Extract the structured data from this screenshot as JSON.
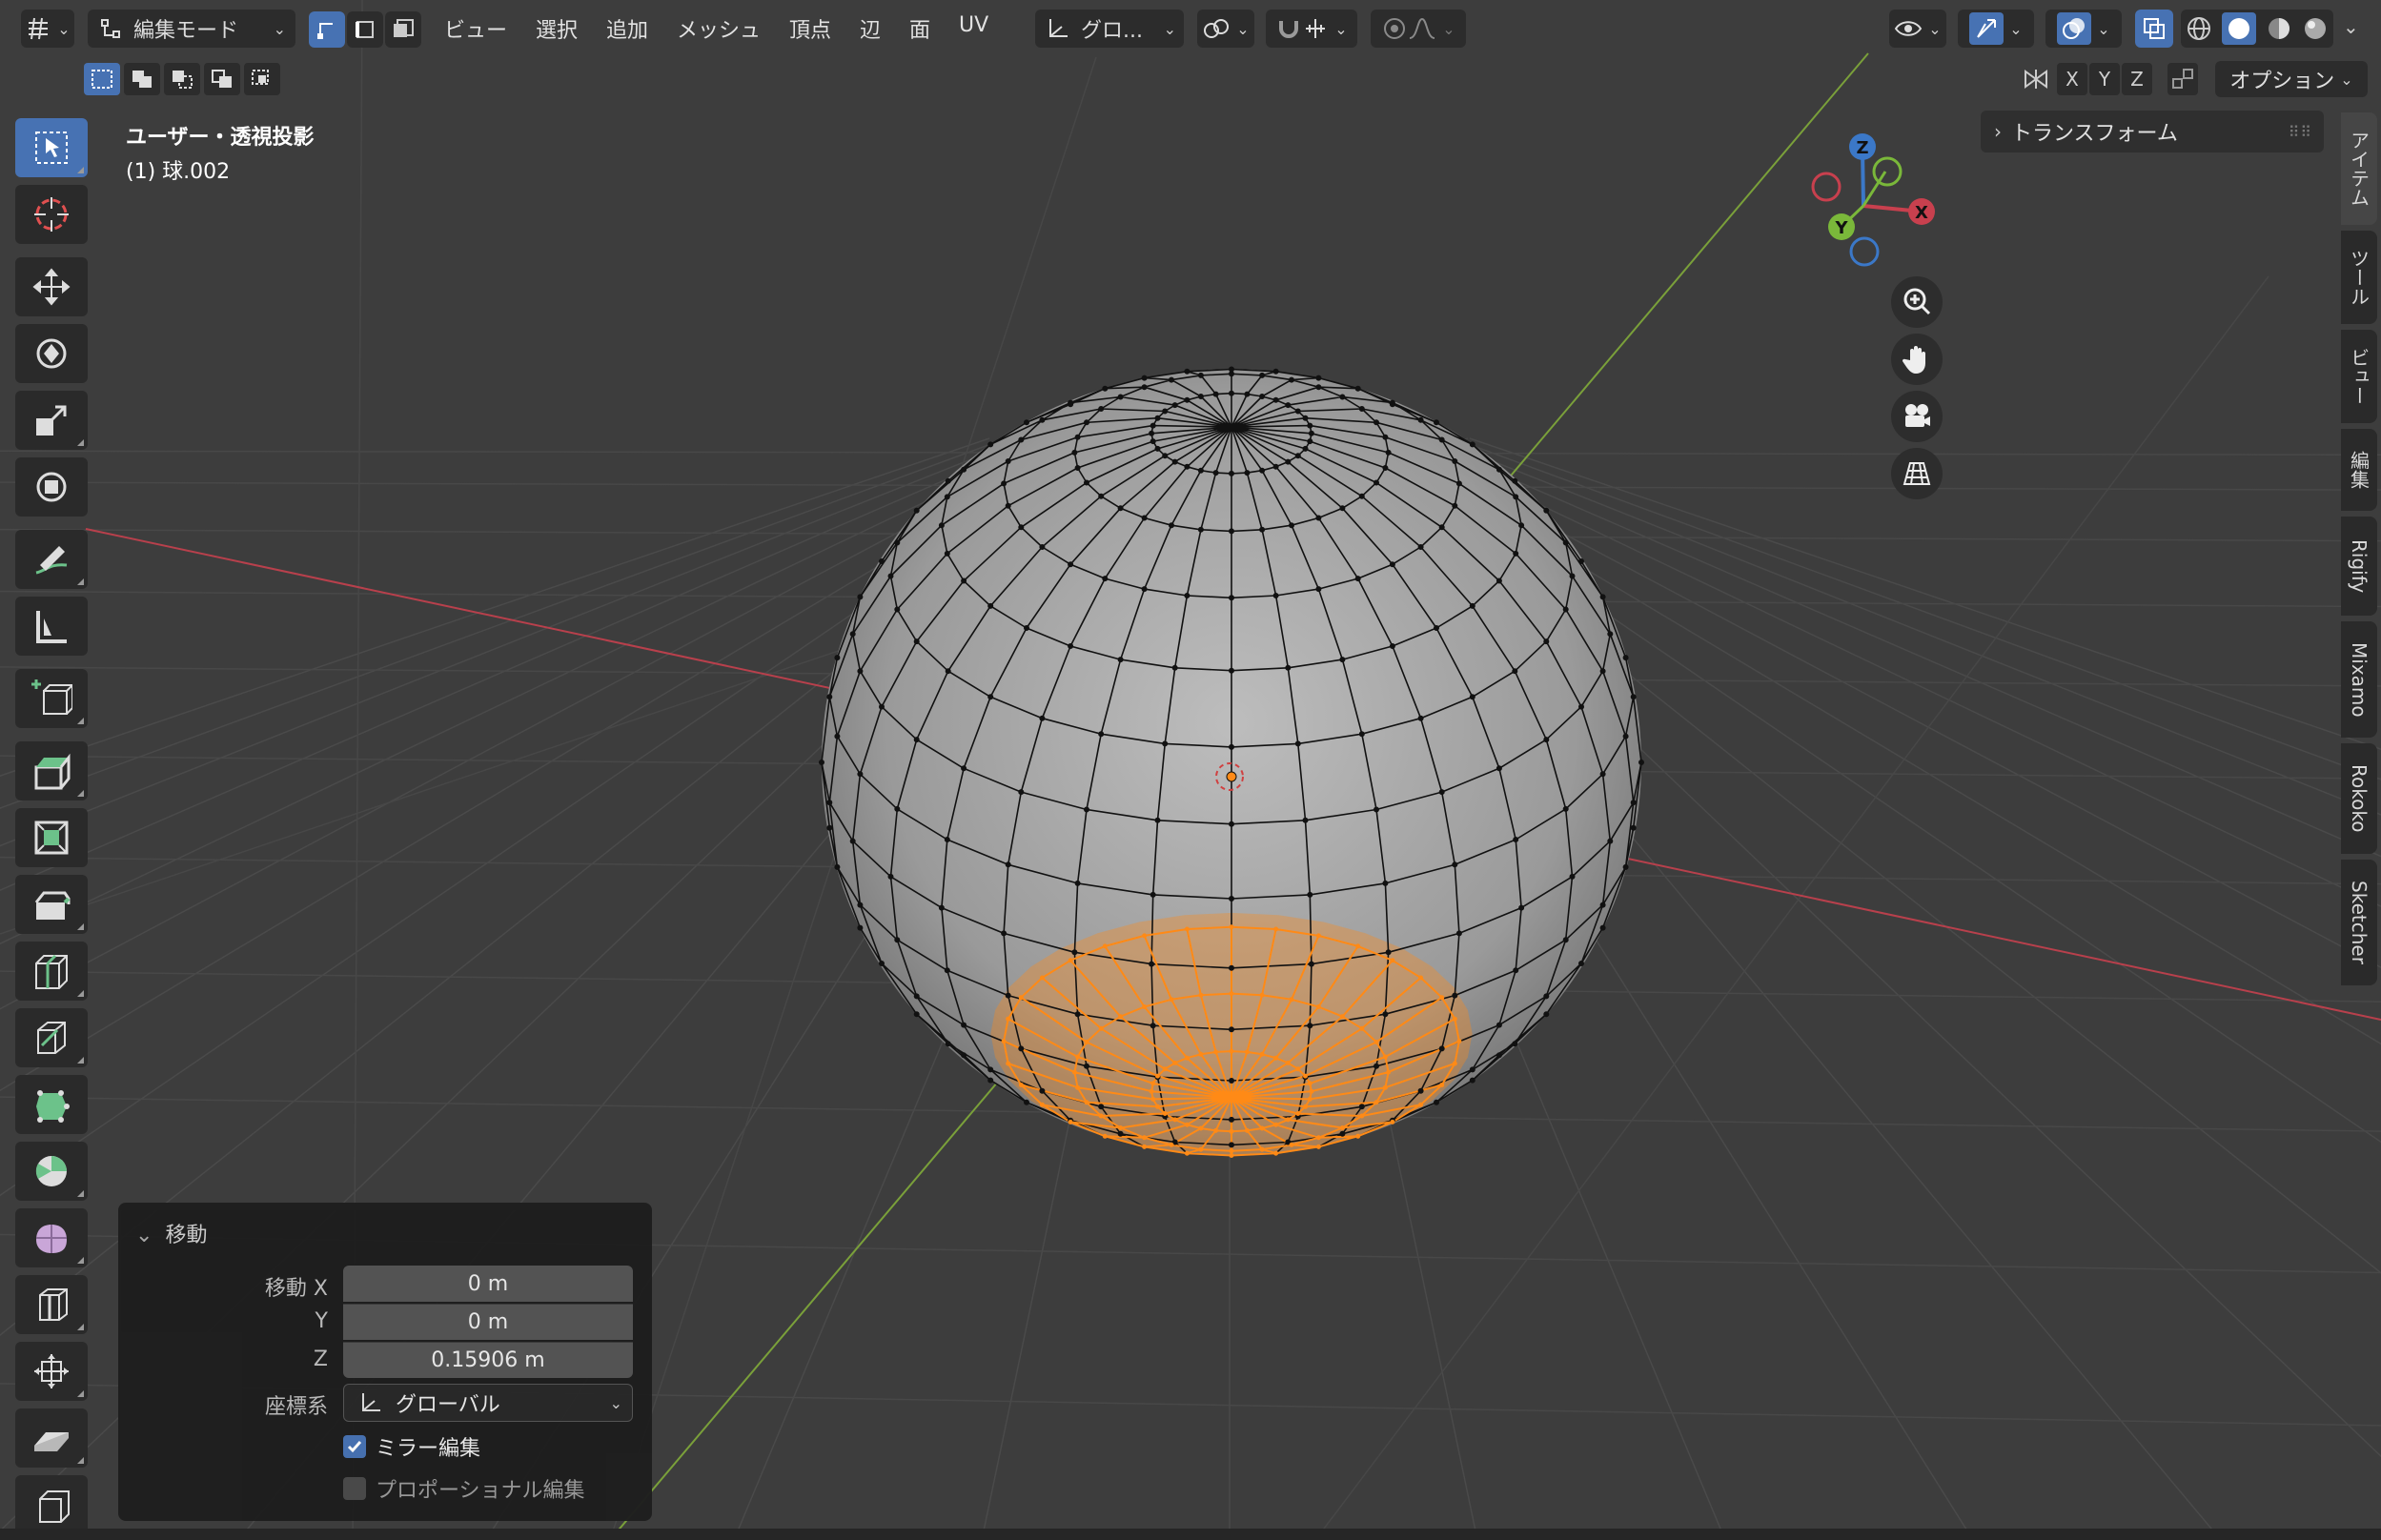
{
  "header": {
    "editor_type_icon": "grid-3d-icon",
    "mode": "編集モード",
    "menus": [
      "ビュー",
      "選択",
      "追加",
      "メッシュ",
      "頂点",
      "辺",
      "面",
      "UV"
    ],
    "transform_orientation": "グロ...",
    "options_label": "オプション",
    "axis_x": "X",
    "axis_y": "Y",
    "axis_z": "Z"
  },
  "viewport": {
    "view_name": "ユーザー・透視投影",
    "object_name": "(1) 球.002",
    "gizmo": {
      "x": "X",
      "y": "Y",
      "z": "Z"
    },
    "colors": {
      "background": "#3d3d3d",
      "x_axis": "#b8404c",
      "y_axis": "#7aa03a",
      "mesh_wire": "#111111",
      "selected": "#ff8a16",
      "sphere_fill": "#a8a8a8"
    }
  },
  "npanel": {
    "transform_header": "トランスフォーム",
    "tabs": [
      "アイテム",
      "ツール",
      "ビュー",
      "編集",
      "Rigify",
      "Mixamo",
      "Rokoko",
      "Sketcher"
    ]
  },
  "operator": {
    "title": "移動",
    "move_label": "移動 X",
    "y_label": "Y",
    "z_label": "Z",
    "x_value": "0 m",
    "y_value": "0 m",
    "z_value": "0.15906 m",
    "orientation_label": "座標系",
    "orientation_value": "グローバル",
    "mirror_label": "ミラー編集",
    "mirror_checked": true,
    "proportional_label": "プロポーショナル編集",
    "proportional_checked": false
  }
}
